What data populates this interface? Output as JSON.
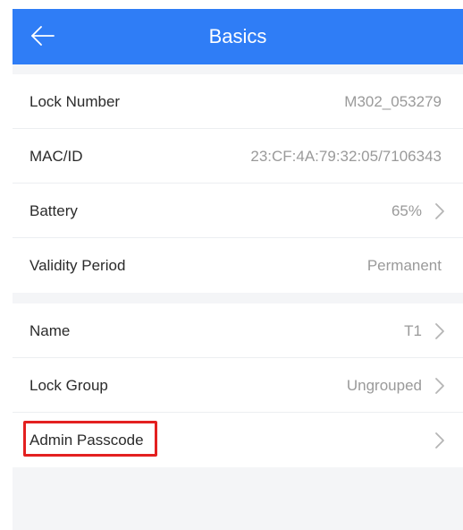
{
  "header": {
    "title": "Basics",
    "background": "#2f7df6"
  },
  "info_group": [
    {
      "label": "Lock Number",
      "value": "M302_053279",
      "chevron": false
    },
    {
      "label": "MAC/ID",
      "value": "23:CF:4A:79:32:05/7106343",
      "chevron": false
    },
    {
      "label": "Battery",
      "value": "65%",
      "chevron": true
    },
    {
      "label": "Validity Period",
      "value": "Permanent",
      "chevron": false
    }
  ],
  "settings_group": [
    {
      "label": "Name",
      "value": "T1",
      "chevron": true
    },
    {
      "label": "Lock Group",
      "value": "Ungrouped",
      "chevron": true
    },
    {
      "label": "Admin Passcode",
      "value": "",
      "chevron": true,
      "highlighted": true
    }
  ],
  "icons": {
    "back": "arrow-left-icon",
    "chevron": "chevron-right-icon"
  },
  "colors": {
    "highlight": "#e32020",
    "label": "#2b2b2b",
    "value": "#9a9a9a",
    "page_background": "#f4f5f7"
  }
}
